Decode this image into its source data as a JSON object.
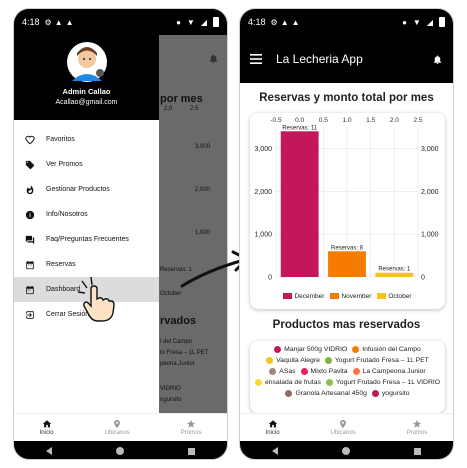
{
  "status": {
    "time": "4:18"
  },
  "left": {
    "bg_title": "por mes",
    "bg_axis": [
      "2.0",
      "2.5"
    ],
    "bg_right_ticks": [
      "3,000",
      "2,000",
      "1,000"
    ],
    "bg_small": [
      "Reservas: 1",
      "October",
      "rvados"
    ],
    "bg_list": [
      "l del Campo",
      "to Fresa – 1L PET",
      "peona Junior",
      "VIDRIO",
      "ogursito"
    ],
    "drawer": {
      "user_name": "Admin Callao",
      "user_email": "Acallao@gmail.com",
      "items": [
        {
          "label": "Favoritos",
          "icon": "heart-icon"
        },
        {
          "label": "Ver Promos",
          "icon": "tag-icon"
        },
        {
          "label": "Gestionar Productos",
          "icon": "flame-icon"
        },
        {
          "label": "Info/Nosotros",
          "icon": "info-icon"
        },
        {
          "label": "Faq/Preguntas Frecuentes",
          "icon": "forum-icon"
        },
        {
          "label": "Reservas",
          "icon": "calendar-icon"
        },
        {
          "label": "Dashboard",
          "icon": "calendar-icon"
        },
        {
          "label": "Cerrar Sesión",
          "icon": "logout-icon"
        }
      ]
    }
  },
  "right": {
    "app_title": "La Lecheria App",
    "chart_title": "Reservas y monto total por mes",
    "products_title": "Productos mas reservados"
  },
  "nav": {
    "items": [
      {
        "label": "Inicio",
        "icon": "home-icon"
      },
      {
        "label": "Ubicanos",
        "icon": "location-pin-icon"
      },
      {
        "label": "Promos",
        "icon": "star-icon"
      }
    ]
  },
  "chart_data": {
    "type": "bar",
    "title": "Reservas y monto total por mes",
    "categories": [
      "December",
      "November",
      "October"
    ],
    "values": [
      3400,
      600,
      100
    ],
    "labels": [
      "Reservas: 11",
      "Reservas: 8",
      "Reservas: 1"
    ],
    "colors": [
      "#c2185b",
      "#f57c00",
      "#f5c518"
    ],
    "ylim": [
      0,
      3500
    ],
    "y_ticks": [
      "0",
      "1,000",
      "2,000",
      "3,000"
    ],
    "x_top_ticks": [
      "-0.5",
      "0.0",
      "0.5",
      "1.0",
      "1.5",
      "2.0",
      "2.5"
    ],
    "legend": [
      "December",
      "November",
      "October"
    ],
    "legend_position": "bottom",
    "grid": true
  },
  "products": [
    {
      "label": "Manjar 500g VIDRIO",
      "color": "#c2185b"
    },
    {
      "label": "Infusión del Campo",
      "color": "#f57c00"
    },
    {
      "label": "Vaquita Alegre",
      "color": "#f5c518"
    },
    {
      "label": "Yogurt Frutado Fresa – 1L PET",
      "color": "#7cb342"
    },
    {
      "label": "ASas",
      "color": "#a1887f"
    },
    {
      "label": "Mixto Pavita",
      "color": "#e91e63"
    },
    {
      "label": "La Campeona Junior",
      "color": "#ff7043"
    },
    {
      "label": "ensalada de frutas",
      "color": "#fdd835"
    },
    {
      "label": "Yogurt Frutado Fresa – 1L VIDRIO",
      "color": "#8bc34a"
    },
    {
      "label": "Granola Artesanal 450g",
      "color": "#8d6e63"
    },
    {
      "label": "yogursito",
      "color": "#c2185b"
    }
  ]
}
